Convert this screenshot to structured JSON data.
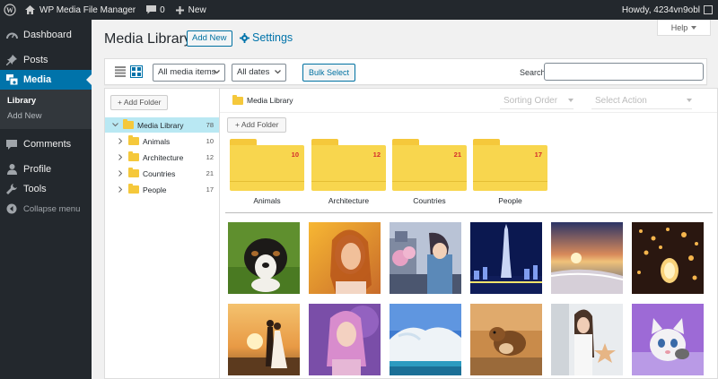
{
  "admin_bar": {
    "site_name": "WP Media File Manager",
    "comments_count": "0",
    "new_label": "New",
    "greeting": "Howdy, 4234vn9obl"
  },
  "sidebar": {
    "items": [
      {
        "label": "Dashboard",
        "icon": "dashboard-icon"
      },
      {
        "label": "Posts",
        "icon": "pin-icon"
      },
      {
        "label": "Media",
        "icon": "media-icon"
      },
      {
        "label": "Comments",
        "icon": "comment-icon"
      },
      {
        "label": "Profile",
        "icon": "user-icon"
      },
      {
        "label": "Tools",
        "icon": "wrench-icon"
      },
      {
        "label": "Collapse menu",
        "icon": "collapse-icon"
      }
    ],
    "submenu": [
      "Library",
      "Add New"
    ]
  },
  "header": {
    "title": "Media Library",
    "add_new": "Add New",
    "settings": "Settings",
    "help": "Help"
  },
  "toolbar": {
    "filter_type": "All media items",
    "filter_date": "All dates",
    "bulk_select": "Bulk Select",
    "search_label": "Search",
    "search_value": ""
  },
  "tree": {
    "add_folder": "Add Folder",
    "root": {
      "label": "Media Library",
      "count": "78"
    },
    "folders": [
      {
        "label": "Animals",
        "count": "10"
      },
      {
        "label": "Architecture",
        "count": "12"
      },
      {
        "label": "Countries",
        "count": "21"
      },
      {
        "label": "People",
        "count": "17"
      }
    ]
  },
  "content": {
    "breadcrumb": "Media Library",
    "sorting_order": "Sorting Order",
    "select_action": "Select Action",
    "add_folder": "Add Folder",
    "folders": [
      {
        "label": "Animals",
        "count": "10"
      },
      {
        "label": "Architecture",
        "count": "12"
      },
      {
        "label": "Countries",
        "count": "21"
      },
      {
        "label": "People",
        "count": "17"
      }
    ],
    "thumbnails": [
      "puppy-photo",
      "woman-sunlight-photo",
      "child-city-photo",
      "burj-khalifa-photo",
      "beach-sunset-photo",
      "sky-lanterns-photo",
      "wedding-sunset-photo",
      "woman-pink-hair-photo",
      "waterfall-photo",
      "squirrel-photo",
      "woman-star-lamp-photo",
      "kitten-photo"
    ]
  },
  "colors": {
    "admin_dark": "#23282d",
    "accent": "#0073aa",
    "folder": "#f8d64e",
    "folder_count": "#d42b2b",
    "tree_selected": "#b9e8f3"
  }
}
